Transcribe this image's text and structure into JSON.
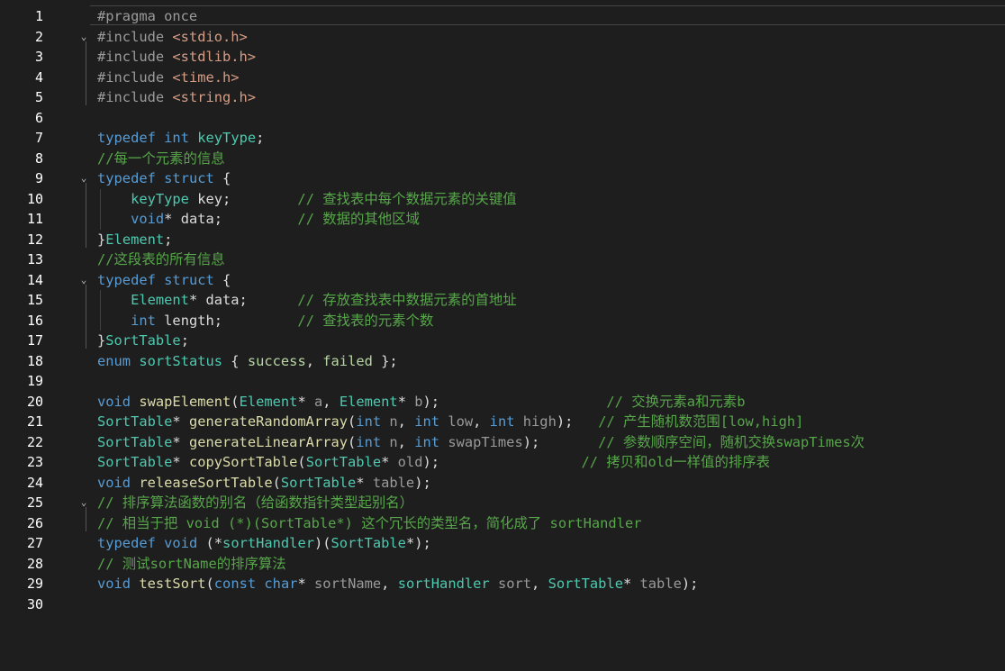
{
  "editor": {
    "lines": [
      {
        "num": "1",
        "fold": "",
        "tokens": [
          {
            "t": "pp",
            "v": "#pragma once"
          }
        ]
      },
      {
        "num": "2",
        "fold": "⌄",
        "tokens": [
          {
            "t": "pp",
            "v": "#include "
          },
          {
            "t": "str",
            "v": "<stdio.h>"
          }
        ]
      },
      {
        "num": "3",
        "fold": "",
        "tokens": [
          {
            "t": "pp",
            "v": "#include "
          },
          {
            "t": "str",
            "v": "<stdlib.h>"
          }
        ]
      },
      {
        "num": "4",
        "fold": "",
        "tokens": [
          {
            "t": "pp",
            "v": "#include "
          },
          {
            "t": "str",
            "v": "<time.h>"
          }
        ]
      },
      {
        "num": "5",
        "fold": "",
        "tokens": [
          {
            "t": "pp",
            "v": "#include "
          },
          {
            "t": "str",
            "v": "<string.h>"
          }
        ]
      },
      {
        "num": "6",
        "fold": "",
        "tokens": []
      },
      {
        "num": "7",
        "fold": "",
        "tokens": [
          {
            "t": "kw",
            "v": "typedef"
          },
          {
            "t": "plain",
            "v": " "
          },
          {
            "t": "kw",
            "v": "int"
          },
          {
            "t": "plain",
            "v": " "
          },
          {
            "t": "type",
            "v": "keyType"
          },
          {
            "t": "plain",
            "v": ";"
          }
        ]
      },
      {
        "num": "8",
        "fold": "",
        "tokens": [
          {
            "t": "cm",
            "v": "//每一个元素的信息"
          }
        ]
      },
      {
        "num": "9",
        "fold": "⌄",
        "tokens": [
          {
            "t": "kw",
            "v": "typedef"
          },
          {
            "t": "plain",
            "v": " "
          },
          {
            "t": "kw",
            "v": "struct"
          },
          {
            "t": "plain",
            "v": " {"
          }
        ]
      },
      {
        "num": "10",
        "fold": "",
        "tokens": [
          {
            "t": "plain",
            "v": "    "
          },
          {
            "t": "type",
            "v": "keyType"
          },
          {
            "t": "plain",
            "v": " key;        "
          },
          {
            "t": "cm",
            "v": "// 查找表中每个数据元素的关键值"
          }
        ]
      },
      {
        "num": "11",
        "fold": "",
        "tokens": [
          {
            "t": "plain",
            "v": "    "
          },
          {
            "t": "kw",
            "v": "void"
          },
          {
            "t": "plain",
            "v": "* data;         "
          },
          {
            "t": "cm",
            "v": "// 数据的其他区域"
          }
        ]
      },
      {
        "num": "12",
        "fold": "",
        "tokens": [
          {
            "t": "plain",
            "v": "}"
          },
          {
            "t": "type",
            "v": "Element"
          },
          {
            "t": "plain",
            "v": ";"
          }
        ]
      },
      {
        "num": "13",
        "fold": "",
        "tokens": [
          {
            "t": "cm",
            "v": "//这段表的所有信息"
          }
        ]
      },
      {
        "num": "14",
        "fold": "⌄",
        "tokens": [
          {
            "t": "kw",
            "v": "typedef"
          },
          {
            "t": "plain",
            "v": " "
          },
          {
            "t": "kw",
            "v": "struct"
          },
          {
            "t": "plain",
            "v": " {"
          }
        ]
      },
      {
        "num": "15",
        "fold": "",
        "tokens": [
          {
            "t": "plain",
            "v": "    "
          },
          {
            "t": "type",
            "v": "Element"
          },
          {
            "t": "plain",
            "v": "* data;      "
          },
          {
            "t": "cm",
            "v": "// 存放查找表中数据元素的首地址"
          }
        ]
      },
      {
        "num": "16",
        "fold": "",
        "tokens": [
          {
            "t": "plain",
            "v": "    "
          },
          {
            "t": "kw",
            "v": "int"
          },
          {
            "t": "plain",
            "v": " length;         "
          },
          {
            "t": "cm",
            "v": "// 查找表的元素个数"
          }
        ]
      },
      {
        "num": "17",
        "fold": "",
        "tokens": [
          {
            "t": "plain",
            "v": "}"
          },
          {
            "t": "type",
            "v": "SortTable"
          },
          {
            "t": "plain",
            "v": ";"
          }
        ]
      },
      {
        "num": "18",
        "fold": "",
        "tokens": [
          {
            "t": "kw",
            "v": "enum"
          },
          {
            "t": "plain",
            "v": " "
          },
          {
            "t": "type",
            "v": "sortStatus"
          },
          {
            "t": "plain",
            "v": " { "
          },
          {
            "t": "enum",
            "v": "success"
          },
          {
            "t": "plain",
            "v": ", "
          },
          {
            "t": "enum",
            "v": "failed"
          },
          {
            "t": "plain",
            "v": " };"
          }
        ]
      },
      {
        "num": "19",
        "fold": "",
        "tokens": []
      },
      {
        "num": "20",
        "fold": "",
        "tokens": [
          {
            "t": "kw",
            "v": "void"
          },
          {
            "t": "plain",
            "v": " "
          },
          {
            "t": "fn",
            "v": "swapElement"
          },
          {
            "t": "plain",
            "v": "("
          },
          {
            "t": "type",
            "v": "Element"
          },
          {
            "t": "plain",
            "v": "* "
          },
          {
            "t": "param",
            "v": "a"
          },
          {
            "t": "plain",
            "v": ", "
          },
          {
            "t": "type",
            "v": "Element"
          },
          {
            "t": "plain",
            "v": "* "
          },
          {
            "t": "param",
            "v": "b"
          },
          {
            "t": "plain",
            "v": ");                    "
          },
          {
            "t": "cm",
            "v": "// 交换元素a和元素b"
          }
        ]
      },
      {
        "num": "21",
        "fold": "",
        "tokens": [
          {
            "t": "type",
            "v": "SortTable"
          },
          {
            "t": "plain",
            "v": "* "
          },
          {
            "t": "fn",
            "v": "generateRandomArray"
          },
          {
            "t": "plain",
            "v": "("
          },
          {
            "t": "kw",
            "v": "int"
          },
          {
            "t": "plain",
            "v": " "
          },
          {
            "t": "param",
            "v": "n"
          },
          {
            "t": "plain",
            "v": ", "
          },
          {
            "t": "kw",
            "v": "int"
          },
          {
            "t": "plain",
            "v": " "
          },
          {
            "t": "param",
            "v": "low"
          },
          {
            "t": "plain",
            "v": ", "
          },
          {
            "t": "kw",
            "v": "int"
          },
          {
            "t": "plain",
            "v": " "
          },
          {
            "t": "param",
            "v": "high"
          },
          {
            "t": "plain",
            "v": ");   "
          },
          {
            "t": "cm",
            "v": "// 产生随机数范围[low,high]"
          }
        ]
      },
      {
        "num": "22",
        "fold": "",
        "tokens": [
          {
            "t": "type",
            "v": "SortTable"
          },
          {
            "t": "plain",
            "v": "* "
          },
          {
            "t": "fn",
            "v": "generateLinearArray"
          },
          {
            "t": "plain",
            "v": "("
          },
          {
            "t": "kw",
            "v": "int"
          },
          {
            "t": "plain",
            "v": " "
          },
          {
            "t": "param",
            "v": "n"
          },
          {
            "t": "plain",
            "v": ", "
          },
          {
            "t": "kw",
            "v": "int"
          },
          {
            "t": "plain",
            "v": " "
          },
          {
            "t": "param",
            "v": "swapTimes"
          },
          {
            "t": "plain",
            "v": ");       "
          },
          {
            "t": "cm",
            "v": "// 参数顺序空间，随机交换swapTimes次"
          }
        ]
      },
      {
        "num": "23",
        "fold": "",
        "tokens": [
          {
            "t": "type",
            "v": "SortTable"
          },
          {
            "t": "plain",
            "v": "* "
          },
          {
            "t": "fn",
            "v": "copySortTable"
          },
          {
            "t": "plain",
            "v": "("
          },
          {
            "t": "type",
            "v": "SortTable"
          },
          {
            "t": "plain",
            "v": "* "
          },
          {
            "t": "param",
            "v": "old"
          },
          {
            "t": "plain",
            "v": ");                 "
          },
          {
            "t": "cm",
            "v": "// 拷贝和old一样值的排序表"
          }
        ]
      },
      {
        "num": "24",
        "fold": "",
        "tokens": [
          {
            "t": "kw",
            "v": "void"
          },
          {
            "t": "plain",
            "v": " "
          },
          {
            "t": "fn",
            "v": "releaseSortTable"
          },
          {
            "t": "plain",
            "v": "("
          },
          {
            "t": "type",
            "v": "SortTable"
          },
          {
            "t": "plain",
            "v": "* "
          },
          {
            "t": "param",
            "v": "table"
          },
          {
            "t": "plain",
            "v": ");"
          }
        ]
      },
      {
        "num": "25",
        "fold": "⌄",
        "tokens": [
          {
            "t": "cm",
            "v": "// 排序算法函数的别名（给函数指针类型起别名）"
          }
        ]
      },
      {
        "num": "26",
        "fold": "",
        "tokens": [
          {
            "t": "cm",
            "v": "// 相当于把 void (*)(SortTable*) 这个冗长的类型名，简化成了 sortHandler"
          }
        ]
      },
      {
        "num": "27",
        "fold": "",
        "tokens": [
          {
            "t": "kw",
            "v": "typedef"
          },
          {
            "t": "plain",
            "v": " "
          },
          {
            "t": "kw",
            "v": "void"
          },
          {
            "t": "plain",
            "v": " (*"
          },
          {
            "t": "type",
            "v": "sortHandler"
          },
          {
            "t": "plain",
            "v": ")("
          },
          {
            "t": "type",
            "v": "SortTable"
          },
          {
            "t": "plain",
            "v": "*);"
          }
        ]
      },
      {
        "num": "28",
        "fold": "",
        "tokens": [
          {
            "t": "cm",
            "v": "// 测试sortName的排序算法"
          }
        ]
      },
      {
        "num": "29",
        "fold": "",
        "tokens": [
          {
            "t": "kw",
            "v": "void"
          },
          {
            "t": "plain",
            "v": " "
          },
          {
            "t": "fn",
            "v": "testSort"
          },
          {
            "t": "plain",
            "v": "("
          },
          {
            "t": "kw",
            "v": "const"
          },
          {
            "t": "plain",
            "v": " "
          },
          {
            "t": "kw",
            "v": "char"
          },
          {
            "t": "plain",
            "v": "* "
          },
          {
            "t": "param",
            "v": "sortName"
          },
          {
            "t": "plain",
            "v": ", "
          },
          {
            "t": "type",
            "v": "sortHandler"
          },
          {
            "t": "plain",
            "v": " "
          },
          {
            "t": "param",
            "v": "sort"
          },
          {
            "t": "plain",
            "v": ", "
          },
          {
            "t": "type",
            "v": "SortTable"
          },
          {
            "t": "plain",
            "v": "* "
          },
          {
            "t": "param",
            "v": "table"
          },
          {
            "t": "plain",
            "v": ");"
          }
        ]
      },
      {
        "num": "30",
        "fold": "",
        "tokens": []
      }
    ]
  }
}
